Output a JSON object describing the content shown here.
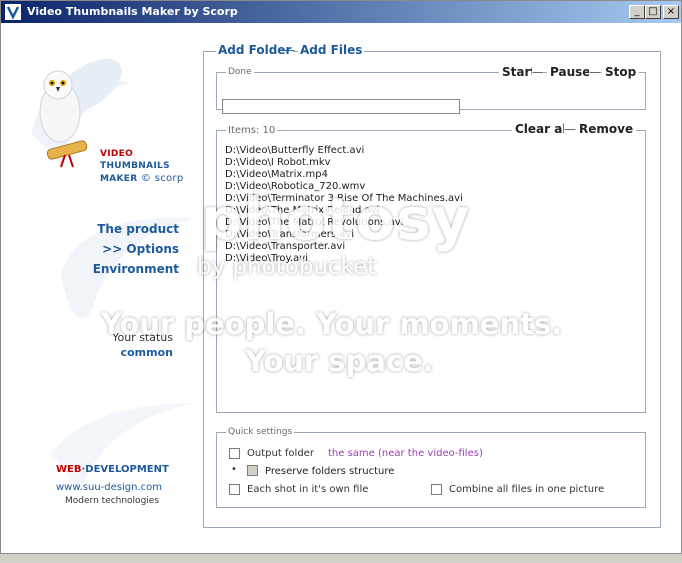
{
  "window": {
    "title": "Video Thumbnails Maker by Scorp",
    "controls": [
      "_",
      "□",
      "×"
    ]
  },
  "brand": {
    "line1": "VIDEO",
    "line2": "THUMBNAILS",
    "line3": "MAKER",
    "copyright": "© scorp"
  },
  "nav": {
    "product": "The product",
    "options": ">> Options",
    "environment": "Environment"
  },
  "status": {
    "label": "Your status",
    "value": "common"
  },
  "footer": {
    "web_prefix": "WEB",
    "web_suffix": "DEVELOPMENT",
    "url": "www.suu-design.com",
    "tagline": "Modern technologies"
  },
  "panel": {
    "add_folder": "Add Folder",
    "add_files": "Add Files",
    "progress": {
      "label": "Done",
      "start": "Start",
      "pause": "Pause",
      "stop": "Stop",
      "value": 0
    },
    "items": {
      "label": "Items: 10",
      "clear_all": "Clear all",
      "remove": "Remove",
      "files": [
        "D:\\Video\\Butterfly Effect.avi",
        "D:\\Video\\I Robot.mkv",
        "D:\\Video\\Matrix.mp4",
        "D:\\Video\\Robotica_720.wmv",
        "D:\\Video\\Terminator 3 Rise Of The Machines.avi",
        "D:\\Video\\The Matrix Reload.avi",
        "D:\\Video\\The Matrix Revolutions.avi",
        "D:\\Video\\Transformers.avi",
        "D:\\Video\\Transporter.avi",
        "D:\\Video\\Troy.avi"
      ]
    },
    "quick": {
      "label": "Quick settings",
      "output_folder": "Output folder",
      "output_value": "the same (near the video-files)",
      "preserve": "Preserve folders structure",
      "each_shot": "Each shot in it's own file",
      "combine": "Combine all files in one picture"
    }
  },
  "watermark": {
    "logo": "photosy",
    "by": "by photobucket",
    "line1": "Your people. Your moments.",
    "line2": "Your space."
  },
  "colors": {
    "accent": "#1d5a9a",
    "brand_red": "#c00000",
    "link_purple": "#9a3fb5"
  }
}
